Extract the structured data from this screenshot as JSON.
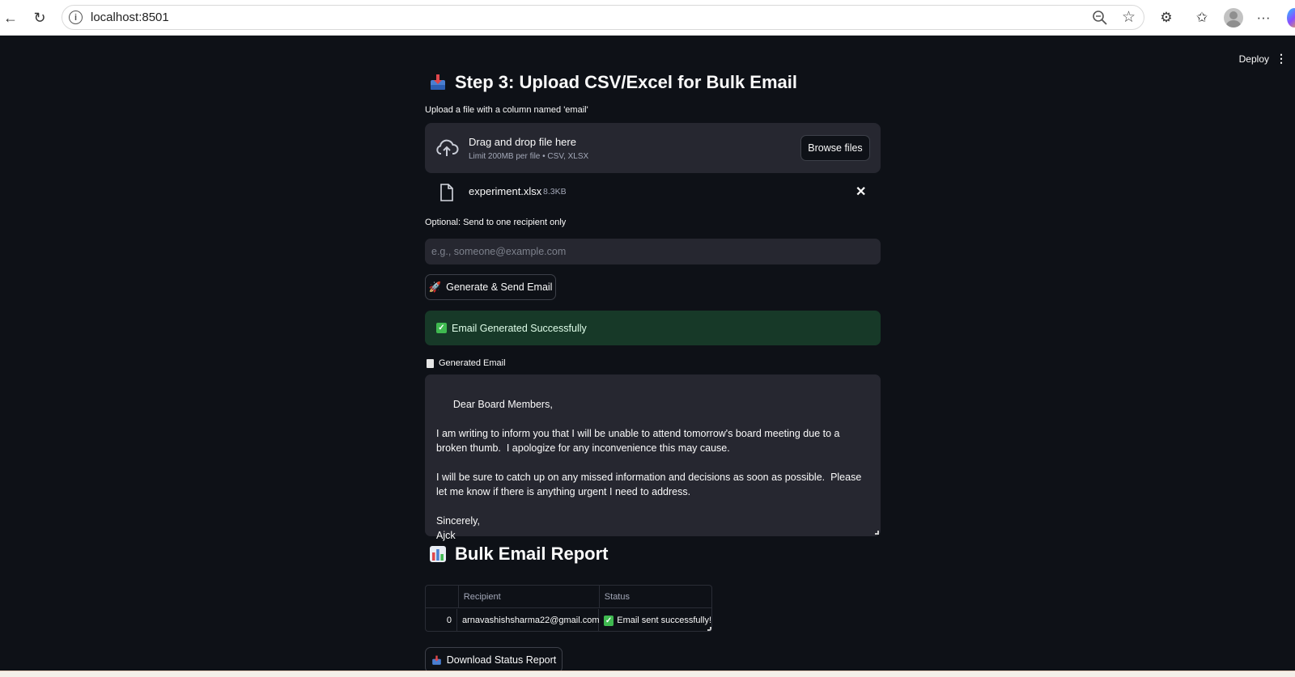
{
  "browser": {
    "url": "localhost:8501"
  },
  "app": {
    "deploy_label": "Deploy",
    "step3": {
      "title": "Step 3: Upload CSV/Excel for Bulk Email",
      "upload_label": "Upload a file with a column named 'email'",
      "dropzone_title": "Drag and drop file here",
      "dropzone_limit": "Limit 200MB per file • CSV, XLSX",
      "browse_label": "Browse files",
      "uploaded_file": {
        "name": "experiment.xlsx",
        "size": "8.3KB"
      },
      "recipient_label": "Optional: Send to one recipient only",
      "recipient_placeholder": "e.g., someone@example.com",
      "recipient_value": "",
      "send_label": "Generate & Send Email",
      "success_message": "Email Generated Successfully",
      "generated_email_label": "Generated Email",
      "generated_email_body": "Dear Board Members,\n\nI am writing to inform you that I will be unable to attend tomorrow's board meeting due to a broken thumb.  I apologize for any inconvenience this may cause.\n\nI will be sure to catch up on any missed information and decisions as soon as possible.  Please let me know if there is anything urgent I need to address.\n\nSincerely,\nAjck"
    },
    "report": {
      "title": "Bulk Email Report",
      "columns": [
        "",
        "Recipient",
        "Status"
      ],
      "rows": [
        {
          "index": "0",
          "recipient": "arnavashishsharma22@gmail.com",
          "status": "Email sent successfully!"
        }
      ],
      "download_label": "Download Status Report"
    }
  },
  "colors": {
    "app_bg": "#0e1117",
    "widget_bg": "#262730",
    "success_bg": "#173928",
    "success_check": "#3fb950"
  }
}
